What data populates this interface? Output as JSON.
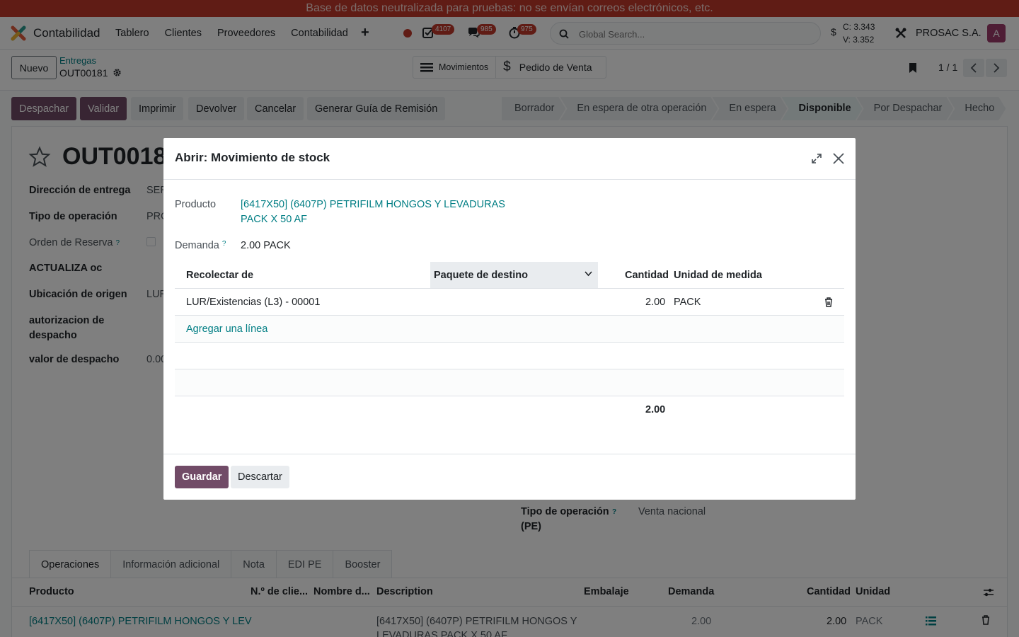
{
  "banner": "Base de datos neutralizada para pruebas: no se envían correos electrónicos, etc.",
  "navbar": {
    "app_name": "Contabilidad",
    "menu": [
      "Tablero",
      "Clientes",
      "Proveedores",
      "Contabilidad"
    ],
    "plus": "+",
    "badges": {
      "activities": "4107",
      "messages": "985",
      "timers": "975"
    },
    "search_placeholder": "Global Search...",
    "currency_symbol": "$",
    "rate_c": "C: 3.343",
    "rate_v": "V: 3.352",
    "company": "PROSAC S.A.",
    "avatar": "A"
  },
  "control_panel": {
    "new_label": "Nuevo",
    "breadcrumb_parent": "Entregas",
    "breadcrumb_current": "OUT00181",
    "smart_buttons": [
      "Movimientos",
      "Pedido de Venta"
    ],
    "pager": "1 / 1"
  },
  "actions": {
    "despachar": "Despachar",
    "validar": "Validar",
    "imprimir": "Imprimir",
    "devolver": "Devolver",
    "cancelar": "Cancelar",
    "guia": "Generar Guía de Remisión"
  },
  "statusbar": [
    "Borrador",
    "En espera de otra operación",
    "En espera",
    "Disponible",
    "Por Despachar",
    "Hecho"
  ],
  "statusbar_active": "Disponible",
  "form": {
    "title": "OUT0018",
    "fields": [
      {
        "label": "Dirección de entrega",
        "value": "SER"
      },
      {
        "label": "Tipo de operación",
        "value": "PRO"
      },
      {
        "label": "Orden de Reserva",
        "value": ""
      },
      {
        "label": "ACTUALIZA oc",
        "value": ""
      },
      {
        "label": "Ubicación de origen",
        "value": "LUR"
      },
      {
        "label": "autorizacion de despacho",
        "value": ""
      },
      {
        "label": "valor de despacho",
        "value": "0.00"
      }
    ],
    "help_mark": "?",
    "op_type_pe_label": "Tipo de operación (PE)",
    "op_type_pe_value": "Venta nacional"
  },
  "tabs": [
    "Operaciones",
    "Información adicional",
    "Nota",
    "EDI PE",
    "Booster"
  ],
  "ops_table": {
    "headers": [
      "Producto",
      "N.º de clie...",
      "Nombre d...",
      "Description",
      "Embalaje",
      "Demanda",
      "Cantidad",
      "Unidad"
    ],
    "row": {
      "product": "[6417X50] (6407P) PETRIFILM HONGOS Y LEV",
      "description_line1": "[6417X50] (6407P) PETRIFILM HONGOS Y",
      "description_line2": "LEVADURAS PACK X 50 AF",
      "demanda": "2.00",
      "cantidad": "2.00",
      "unidad": "PACK"
    }
  },
  "modal": {
    "title": "Abrir: Movimiento de stock",
    "product_label": "Producto",
    "product_line1": "[6417X50] (6407P) PETRIFILM HONGOS Y LEVADURAS",
    "product_line2": "PACK X 50 AF",
    "demand_label": "Demanda",
    "demand_value": "2.00",
    "demand_uom": "PACK",
    "table_headers": {
      "from": "Recolectar de",
      "package": "Paquete de destino",
      "qty": "Cantidad",
      "uom": "Unidad de medida"
    },
    "line": {
      "from": "LUR/Existencias (L3) - 00001",
      "qty": "2.00",
      "uom": "PACK"
    },
    "add_line": "Agregar una línea",
    "total": "2.00",
    "save": "Guardar",
    "discard": "Descartar"
  }
}
